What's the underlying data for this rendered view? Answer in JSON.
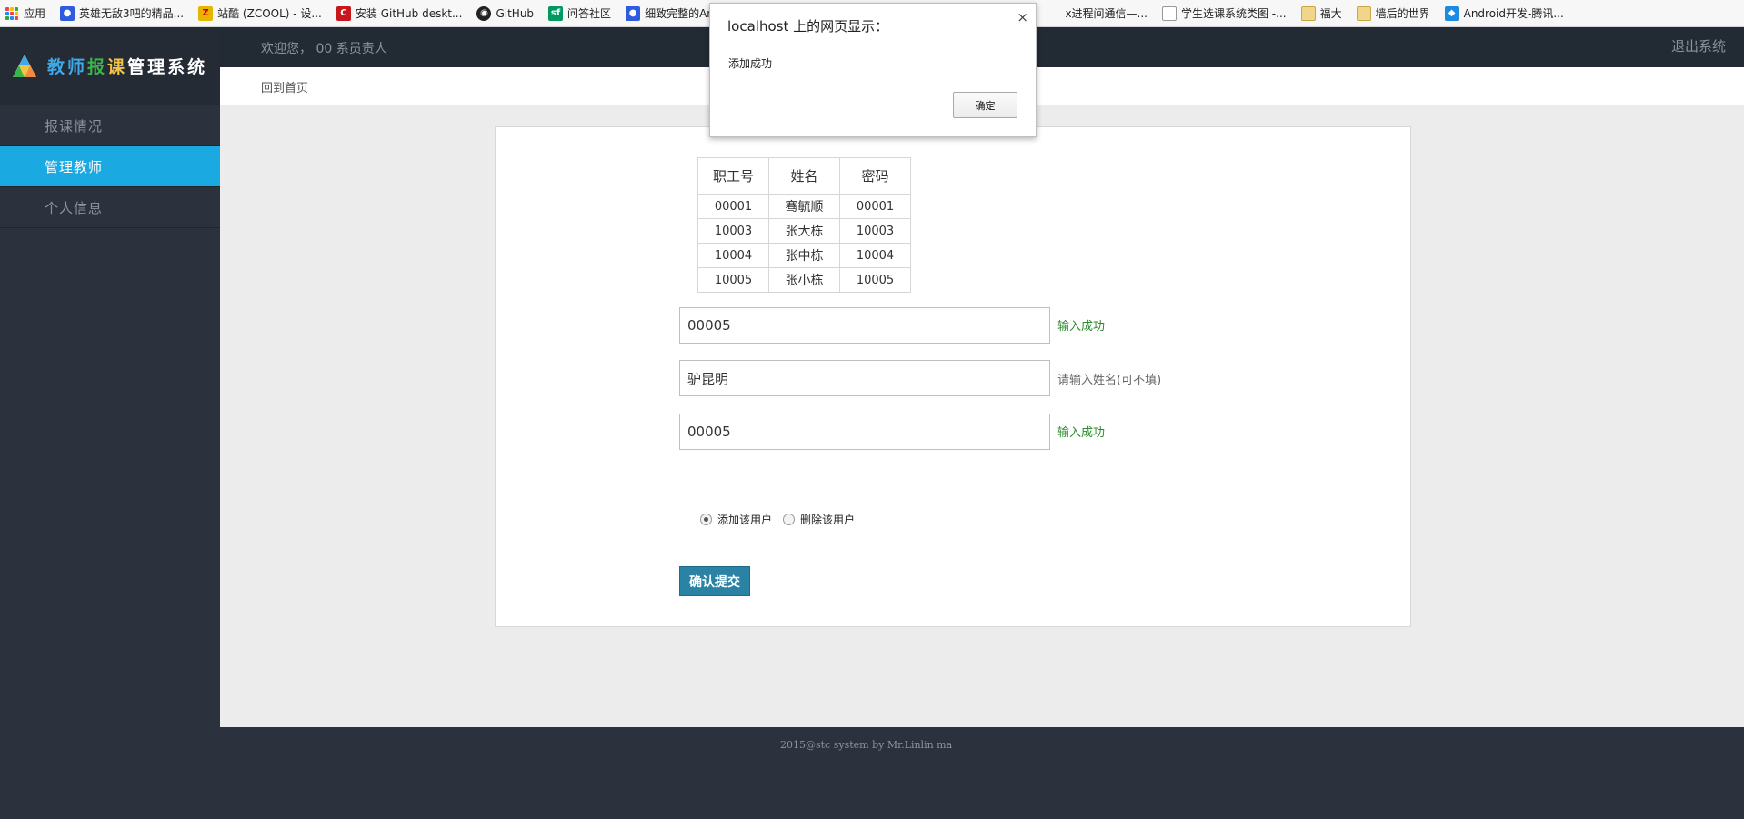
{
  "bookmarks": [
    {
      "label": "应用",
      "icon": "apps-grid-icon"
    },
    {
      "label": "英雄无敌3吧的精品...",
      "icon": "baidu-paw-icon",
      "color": "#2d5ce0"
    },
    {
      "label": "站酷 (ZCOOL) - 设...",
      "icon": "zcool-icon",
      "color": "#e8b400"
    },
    {
      "label": "安装 GitHub deskt...",
      "icon": "csdn-icon",
      "color": "#c8161d"
    },
    {
      "label": "GitHub",
      "icon": "github-icon",
      "color": "#222222"
    },
    {
      "label": "问答社区",
      "icon": "segmentfault-icon",
      "color": "#009a61"
    },
    {
      "label": "细致完整的Andr",
      "icon": "baidu-paw-icon",
      "color": "#2d5ce0"
    }
  ],
  "bookmarks_right": [
    {
      "label": "x进程间通信—...",
      "icon": "page-icon"
    },
    {
      "label": "学生选课系统类图 -...",
      "icon": "page-icon"
    },
    {
      "label": "福大",
      "icon": "folder-icon"
    },
    {
      "label": "墙后的世界",
      "icon": "folder-icon"
    },
    {
      "label": "Android开发-腾讯...",
      "icon": "tencent-icon"
    }
  ],
  "app": {
    "logo_chars": [
      "教",
      "师",
      "报",
      "课",
      "管",
      "理",
      "系",
      "统"
    ],
    "welcome": "欢迎您， 00 系员责人",
    "logout": "退出系统",
    "back_home": "回到首页"
  },
  "sidebar": {
    "items": [
      {
        "label": "报课情况",
        "active": false
      },
      {
        "label": "管理教师",
        "active": true
      },
      {
        "label": "个人信息",
        "active": false
      }
    ]
  },
  "table": {
    "headers": [
      "职工号",
      "姓名",
      "密码"
    ],
    "rows": [
      [
        "00001",
        "骞毓顺",
        "00001"
      ],
      [
        "10003",
        "张大栋",
        "10003"
      ],
      [
        "10004",
        "张中栋",
        "10004"
      ],
      [
        "10005",
        "张小栋",
        "10005"
      ]
    ]
  },
  "form": {
    "id_value": "00005",
    "id_hint": "输入成功",
    "name_value": "驴昆明",
    "name_hint": "请输入姓名(可不填)",
    "password_value": "00005",
    "password_hint": "输入成功",
    "radio_add": "添加该用户",
    "radio_delete": "删除该用户",
    "selected": "add",
    "submit": "确认提交"
  },
  "footer": "2015@stc system by Mr.Linlin ma",
  "dialog": {
    "title": "localhost 上的网页显示：",
    "message": "添加成功",
    "ok": "确定",
    "close": "×"
  }
}
